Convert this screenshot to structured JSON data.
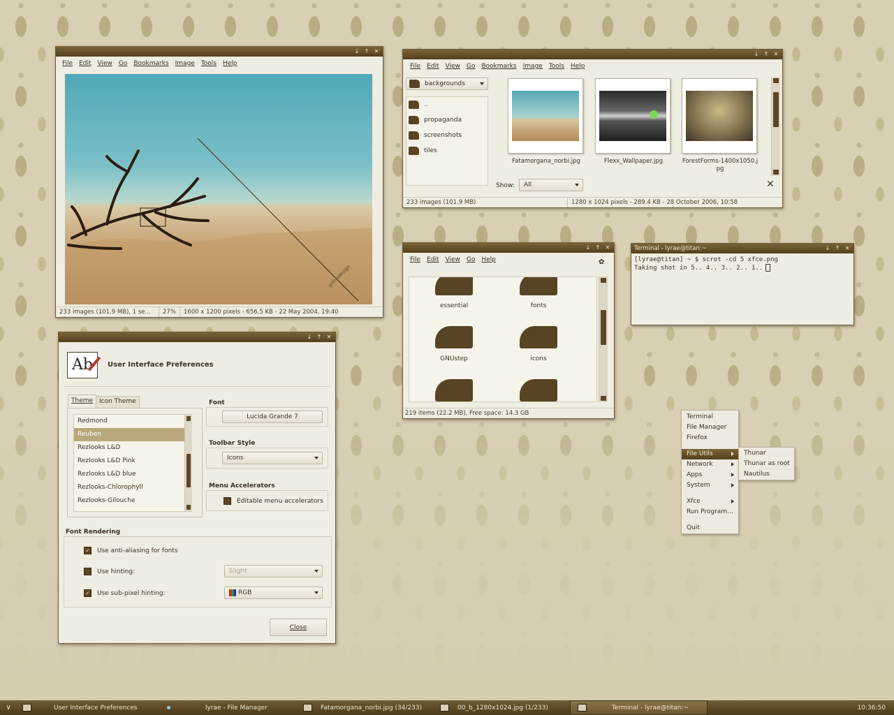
{
  "image_viewer": {
    "menu": [
      "File",
      "Edit",
      "View",
      "Go",
      "Bookmarks",
      "Image",
      "Tools",
      "Help"
    ],
    "watermark": "pimpdesign",
    "status": [
      "233 images (101.9 MB), 1 se...",
      "27%",
      "1600 x 1200 pixels - 656.5 KB - 22 May 2004, 19:40"
    ]
  },
  "file_browser": {
    "menu": [
      "File",
      "Edit",
      "View",
      "Go",
      "Bookmarks",
      "Image",
      "Tools",
      "Help"
    ],
    "location": "backgrounds",
    "folders": [
      "..",
      "propaganda",
      "screenshots",
      "tiles"
    ],
    "thumbnails": [
      "Fatamorgana_norbi.jpg",
      "Flexx_Wallpaper.jpg",
      "ForestForms-1400x1050.jpg"
    ],
    "show_label": "Show:",
    "show_value": "All",
    "status_left": "233 images (101.9 MB)",
    "status_right": "1280 x 1024 pixels - 289.4 KB - 28 October 2006, 10:58"
  },
  "file_manager": {
    "menu": [
      "File",
      "Edit",
      "View",
      "Go",
      "Help"
    ],
    "items": [
      "essential",
      "fonts",
      "GNUstep",
      "icons"
    ],
    "status": "219 items (22.2 MB), Free space: 14.3 GB"
  },
  "terminal": {
    "title": "Terminal - lyrae@titan:~",
    "prompt": "[lyrae@titan] ~ $ scrot -cd 5 xfce.png",
    "output": "Taking shot in 5.. 4.. 3.. 2.. 1.."
  },
  "ui_prefs": {
    "header": "User Interface Preferences",
    "icon_glyph": "Ab",
    "tabs": [
      "Theme",
      "Icon Theme"
    ],
    "themes": [
      "Redmond",
      "Reuben",
      "Rezlooks L&D",
      "Rezlooks L&D Pink",
      "Rezlooks L&D blue",
      "Rezlooks-Chlorophyll",
      "Rezlooks-Gilouche"
    ],
    "selected_theme": "Reuben",
    "font_label": "Font",
    "font_value": "Lucida Grande 7",
    "toolbar_label": "Toolbar Style",
    "toolbar_value": "Icons",
    "accel_label": "Menu Accelerators",
    "accel_check": "Editable menu accelerators",
    "render_label": "Font Rendering",
    "antialias": "Use anti-aliasing for fonts",
    "hinting": "Use hinting:",
    "hinting_value": "Slight",
    "subpixel": "Use sub-pixel hinting:",
    "subpixel_value": "RGB",
    "close": "Close"
  },
  "desktop_menu": {
    "items": [
      "Terminal",
      "File Manager",
      "Firefox",
      "File Utils",
      "Network",
      "Apps",
      "System",
      "Xfce",
      "Run Program...",
      "Quit"
    ],
    "submenu": [
      "Thunar",
      "Thunar as root",
      "Nautilus"
    ]
  },
  "taskbar": {
    "tasks": [
      "User Interface Preferences",
      "lyrae - File Manager",
      "Fatamorgana_norbi.jpg  (34/233)",
      "00_b_1280x1024.jpg  (1/233)",
      "Terminal - lyrae@titan:~"
    ],
    "clock": "10:36:50"
  },
  "colors": {
    "accent": "#5b4626",
    "titlebar": "#6b5530",
    "window": "#efece2",
    "wallpaper": "#d9d0b4"
  }
}
